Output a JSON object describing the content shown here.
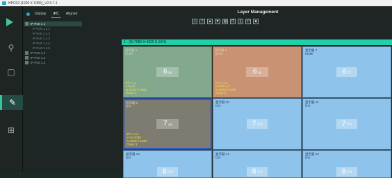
{
  "window": {
    "title": "HPC02 (1920 X 1080)_V2.0.7.1"
  },
  "rail": {
    "items": [
      {
        "icon": "search-icon"
      },
      {
        "icon": "monitor-icon"
      },
      {
        "icon": "edit-icon"
      },
      {
        "icon": "grid-icon"
      }
    ]
  },
  "panel": {
    "tabs": [
      {
        "label": "Display"
      },
      {
        "label": "IPC"
      },
      {
        "label": "Aligned"
      }
    ],
    "tree": [
      {
        "label": "IP Port 1 1",
        "level": 1,
        "selected": true
      },
      {
        "label": "IP Port 1.1.1",
        "level": 2
      },
      {
        "label": "IP Port 1.1.2",
        "level": 2
      },
      {
        "label": "IP Port 1.1.3",
        "level": 2
      },
      {
        "label": "IP Port 1.1.4",
        "level": 2
      },
      {
        "label": "IP Port 1.1.5",
        "level": 2
      },
      {
        "label": "IP Port 1.2",
        "level": 1
      },
      {
        "label": "IP Port 1.3",
        "level": 1
      },
      {
        "label": "IP Port 1.4",
        "level": 1
      }
    ]
  },
  "workspace": {
    "title": "Layer Management",
    "toolbar": [
      {
        "icon": "align-icon",
        "glyph": "⊥"
      },
      {
        "icon": "top-icon",
        "glyph": "⊤"
      },
      {
        "icon": "up-icon",
        "glyph": "▲"
      },
      {
        "icon": "down-icon",
        "glyph": "▼"
      },
      {
        "icon": "layers-icon",
        "glyph": "▤"
      },
      {
        "icon": "copy-icon",
        "glyph": "❐"
      },
      {
        "icon": "file-icon",
        "glyph": "▯"
      },
      {
        "icon": "undo-icon",
        "glyph": "↶"
      },
      {
        "icon": "save-icon",
        "glyph": "■"
      }
    ],
    "canvas_header": "1 - (W:7680 H:4320 S:16%)",
    "cells": [
      {
        "name": "显示器 5",
        "src": "HDMI",
        "num": "6",
        "sub": "[5]"
      },
      {
        "name": "显示器 6",
        "src": "HDMI",
        "num": "6",
        "sub": "[6]"
      },
      {
        "name": "显示器 7",
        "src": "HDMI",
        "num": "6",
        "sub": "[7]"
      },
      {
        "name": "显示器 9",
        "src": "DVI",
        "num": "7",
        "sub": "[9]"
      },
      {
        "name": "显示器 10",
        "src": "DVI",
        "num": "7",
        "sub": "[10]"
      },
      {
        "name": "显示器 11",
        "src": "DVI",
        "num": "7",
        "sub": "[11]"
      },
      {
        "name": "显示器 13",
        "src": "DVI",
        "num": "8",
        "sub": "[13]"
      },
      {
        "name": "显示器 14",
        "src": "DVI",
        "num": "8",
        "sub": "[14]"
      },
      {
        "name": "显示器 15",
        "src": "DVI",
        "num": "8",
        "sub": "[15]"
      }
    ],
    "layers": [
      {
        "style": "green",
        "name": "显示器 5",
        "src": "HDMI",
        "num": "6",
        "sub": "[5]",
        "ipc": "IPC 1.1",
        "pos": "x:0 y:0",
        "size": "w:1920 h:1080",
        "order": "Order:1"
      },
      {
        "style": "brown",
        "name": "显示器 6",
        "src": "HDMI",
        "num": "6",
        "sub": "[6]",
        "ipc": "IPC 1.12",
        "pos": "x:1920 y:0",
        "size": "w:1920 h:1080",
        "order": "Order:2"
      },
      {
        "style": "gray",
        "name": "显示器 9",
        "src": "DVI",
        "num": "7",
        "sub": "[9]",
        "ipc": "IPC 1.11",
        "pos": "x:0 y:1080",
        "size": "w:1920 h:1080",
        "order": "Order:3"
      }
    ]
  }
}
